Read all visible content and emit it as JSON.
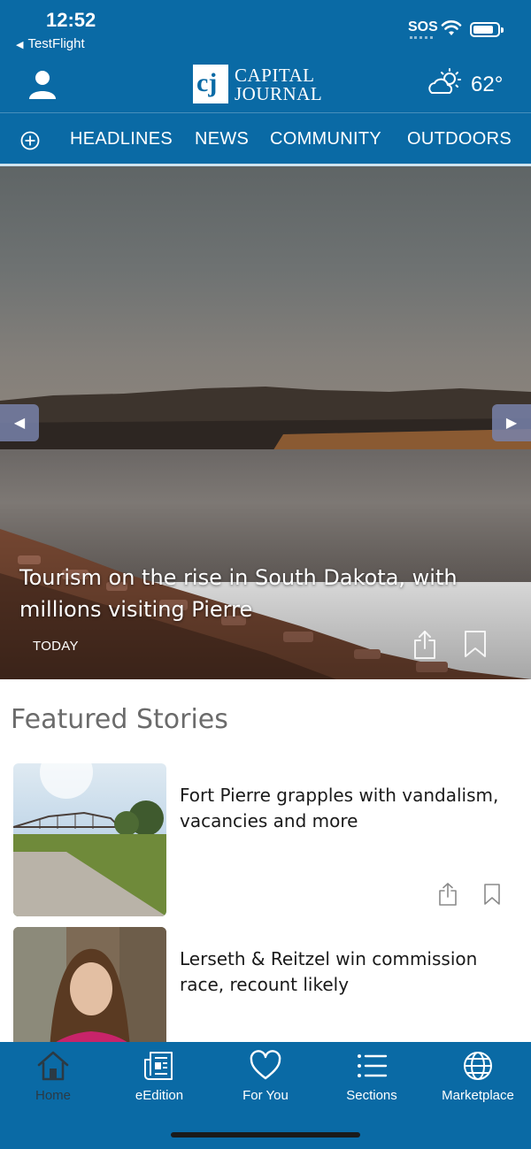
{
  "status_bar": {
    "time": "12:52",
    "back_app": "TestFlight",
    "sos": "SOS"
  },
  "header": {
    "logo_mark": "cj",
    "logo_line1": "CAPITAL",
    "logo_line2": "JOURNAL",
    "temperature": "62°",
    "weather_icon": "partly-cloudy-icon",
    "account_icon": "user-icon"
  },
  "nav": {
    "add_icon": "plus-circle-icon",
    "tabs": [
      "HEADLINES",
      "NEWS",
      "COMMUNITY",
      "OUTDOORS"
    ]
  },
  "hero": {
    "title": "Tourism on the rise in South Dakota, with millions visiting Pierre",
    "date": "TODAY",
    "prev_icon": "triangle-left-icon",
    "next_icon": "triangle-right-icon"
  },
  "featured": {
    "heading": "Featured Stories",
    "stories": [
      {
        "title": "Fort Pierre grapples with vandalism, vacancies and more"
      },
      {
        "title": "Lerseth & Reitzel win commission race, recount likely"
      }
    ]
  },
  "tabbar": {
    "items": [
      {
        "label": "Home",
        "icon": "home-icon",
        "active": true
      },
      {
        "label": "eEdition",
        "icon": "newspaper-icon",
        "active": false
      },
      {
        "label": "For You",
        "icon": "heart-icon",
        "active": false
      },
      {
        "label": "Sections",
        "icon": "list-icon",
        "active": false
      },
      {
        "label": "Marketplace",
        "icon": "globe-icon",
        "active": false
      }
    ]
  },
  "colors": {
    "brand": "#0a6aa5",
    "active_tab": "#2b3a44"
  }
}
